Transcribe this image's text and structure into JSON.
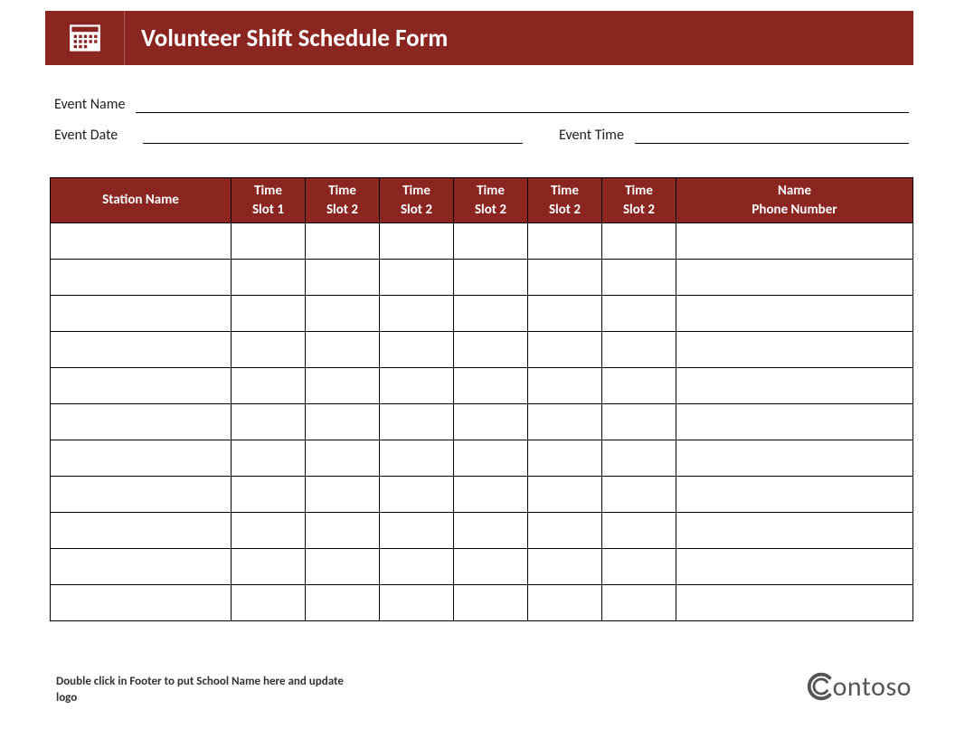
{
  "header": {
    "title": "Volunteer Shift Schedule Form",
    "icon": "calendar-icon"
  },
  "fields": {
    "event_name_label": "Event Name",
    "event_date_label": "Event Date",
    "event_time_label": "Event Time",
    "event_name_value": "",
    "event_date_value": "",
    "event_time_value": ""
  },
  "table": {
    "headers": {
      "station": "Station Name",
      "slot1": "Time Slot 1",
      "slot2": "Time Slot 2",
      "slot3": "Time Slot 2",
      "slot4": "Time Slot 2",
      "slot5": "Time Slot 2",
      "slot6": "Time Slot 2",
      "name_phone": "Name\nPhone Number"
    },
    "row_count": 11
  },
  "footer": {
    "note": "Double click in Footer to put School Name here and update logo",
    "logo_text": "ontoso"
  },
  "colors": {
    "brand": "#8B2520"
  }
}
